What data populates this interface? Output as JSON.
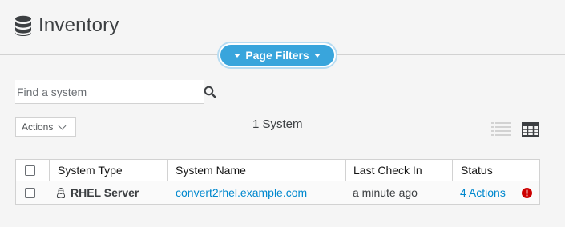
{
  "header": {
    "title": "Inventory",
    "title_icon": "database-icon"
  },
  "filters": {
    "label": "Page Filters"
  },
  "search": {
    "placeholder": "Find a system",
    "value": ""
  },
  "toolbar": {
    "actions_label": "Actions",
    "count_label": "1 System"
  },
  "table": {
    "columns": [
      "System Type",
      "System Name",
      "Last Check In",
      "Status"
    ],
    "rows": [
      {
        "system_type": "RHEL Server",
        "system_type_icon": "linux-icon",
        "system_name": "convert2rhel.example.com",
        "last_check_in": "a minute ago",
        "status": "4 Actions",
        "status_icon": "critical-alert-icon"
      }
    ]
  },
  "colors": {
    "accent": "#39a5dc",
    "link": "#0088ce",
    "critical": "#cc0000"
  }
}
